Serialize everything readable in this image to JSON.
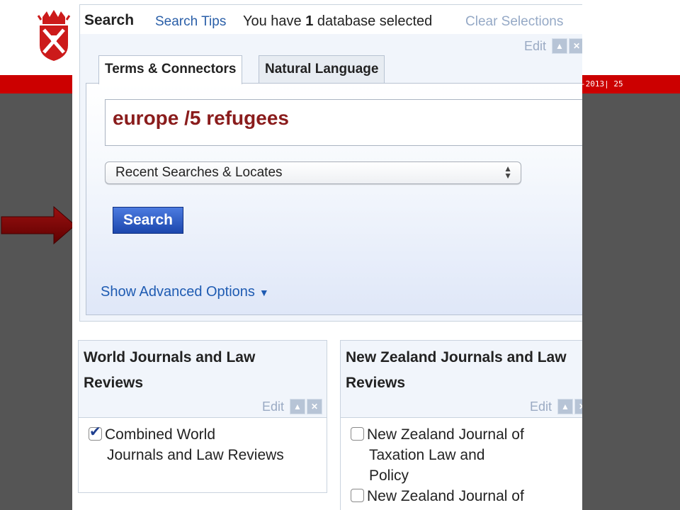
{
  "slide": {
    "footer_text": "-2013| 25",
    "colors": {
      "red_bar": "#cc0000",
      "background": "#555555",
      "arrow": "#7a0000"
    }
  },
  "topbar": {
    "search_label": "Search",
    "search_tips": "Search Tips",
    "db_prefix": "You have ",
    "db_count": "1",
    "db_suffix": " database selected",
    "clear_selections": "Clear Selections"
  },
  "search_panel": {
    "edit_label": "Edit",
    "tabs": [
      {
        "label": "Terms & Connectors",
        "active": true
      },
      {
        "label": "Natural Language",
        "active": false
      }
    ],
    "query_value": "europe /5 refugees",
    "recent_select_value": "Recent Searches & Locates",
    "search_button": "Search",
    "advanced_options": "Show Advanced Options"
  },
  "panels": [
    {
      "title": "World Journals and Law Reviews",
      "edit_label": "Edit",
      "items": [
        {
          "label_line1": "Combined World",
          "label_rest": "Journals and Law Reviews",
          "checked": true
        }
      ]
    },
    {
      "title": "New Zealand Journals and Law Reviews",
      "edit_label": "Edit",
      "items": [
        {
          "label_line1": "New Zealand Journal of",
          "label_rest": "Taxation Law and Policy",
          "checked": false
        },
        {
          "label_line1": "New Zealand Journal of",
          "label_rest": "",
          "checked": false
        }
      ]
    }
  ],
  "icons": [
    "university-crest-icon",
    "right-arrow-icon",
    "up-arrow-icon",
    "close-icon",
    "chevron-down-icon",
    "updown-select-icon",
    "checkmark-icon"
  ]
}
